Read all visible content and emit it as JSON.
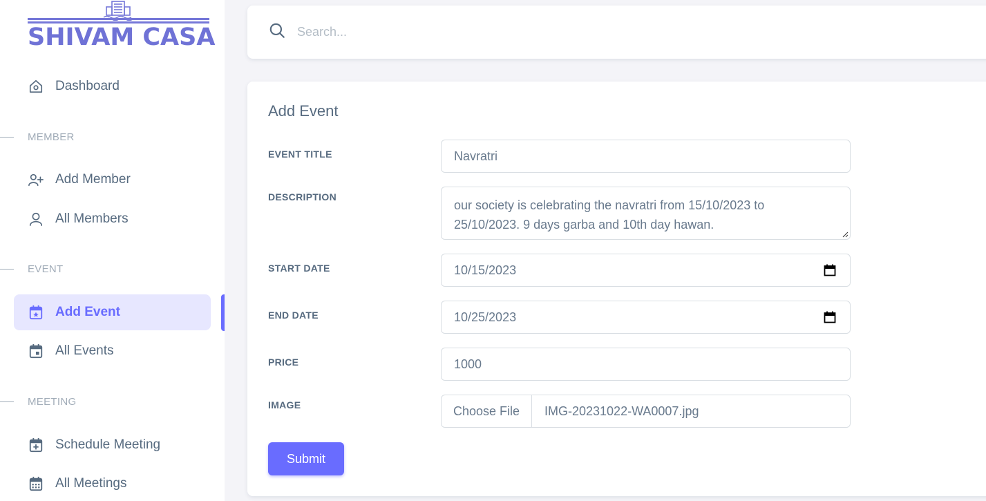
{
  "brand": {
    "name": "SHIVAM CASA",
    "color": "#6f72d6"
  },
  "sidebar": {
    "dashboard": {
      "label": "Dashboard",
      "icon": "home-icon"
    },
    "sections": {
      "member": "MEMBER",
      "event": "EVENT",
      "meeting": "MEETING"
    },
    "items": {
      "add_member": {
        "label": "Add Member",
        "icon": "user-plus-icon"
      },
      "all_members": {
        "label": "All Members",
        "icon": "user-icon"
      },
      "add_event": {
        "label": "Add Event",
        "icon": "calendar-star-icon",
        "active": true
      },
      "all_events": {
        "label": "All Events",
        "icon": "calendar-icon"
      },
      "schedule_meeting": {
        "label": "Schedule Meeting",
        "icon": "calendar-plus-icon"
      },
      "all_meetings": {
        "label": "All Meetings",
        "icon": "calendar-grid-icon"
      }
    }
  },
  "search": {
    "placeholder": "Search..."
  },
  "form": {
    "title": "Add Event",
    "event_title": {
      "label": "EVENT TITLE",
      "value": "Navratri"
    },
    "description": {
      "label": "DESCRIPTION",
      "value": "our society is celebrating the navratri from 15/10/2023 to 25/10/2023. 9 days garba and 10th day hawan."
    },
    "start_date": {
      "label": "START DATE",
      "value": "10/15/2023"
    },
    "end_date": {
      "label": "END DATE",
      "value": "10/25/2023"
    },
    "price": {
      "label": "PRICE",
      "value": "1000"
    },
    "image": {
      "label": "IMAGE",
      "button": "Choose File",
      "filename": "IMG-20231022-WA0007.jpg"
    },
    "submit_label": "Submit"
  },
  "colors": {
    "accent": "#696cff",
    "active_bg": "#e7e7ff",
    "text": "#566a7f",
    "muted": "#a1acb8"
  }
}
